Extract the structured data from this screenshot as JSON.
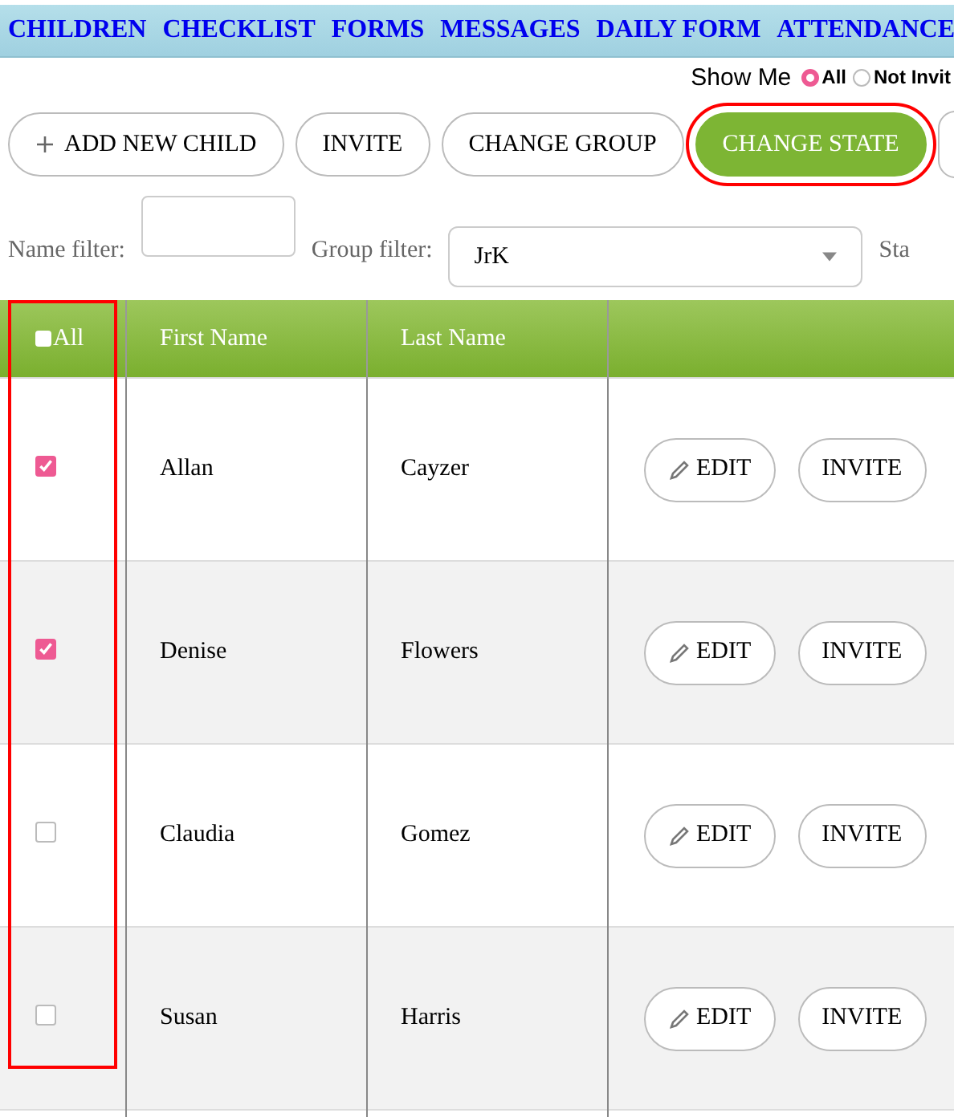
{
  "nav": [
    {
      "label": "CHILDREN"
    },
    {
      "label": "CHECKLIST"
    },
    {
      "label": "FORMS"
    },
    {
      "label": "MESSAGES"
    },
    {
      "label": "DAILY FORM"
    },
    {
      "label": "ATTENDANCE"
    }
  ],
  "show_me": {
    "label": "Show Me",
    "options": [
      {
        "label": "All",
        "selected": true
      },
      {
        "label": "Not Invit",
        "selected": false
      }
    ]
  },
  "actions": [
    {
      "label": "ADD NEW CHILD",
      "kind": "add",
      "primary": false,
      "highlighted": false
    },
    {
      "label": "INVITE",
      "kind": "plain",
      "primary": false,
      "highlighted": false
    },
    {
      "label": "CHANGE GROUP",
      "kind": "plain",
      "primary": false,
      "highlighted": false
    },
    {
      "label": "CHANGE STATE",
      "kind": "plain",
      "primary": true,
      "highlighted": true
    }
  ],
  "filters": {
    "name_label": "Name filter:",
    "group_label": "Group filter:",
    "group_value": "JrK",
    "state_label": "Sta"
  },
  "table": {
    "select_all": {
      "label": "All",
      "checked": false
    },
    "columns": [
      "First Name",
      "Last Name"
    ],
    "checkbox_column_highlighted": true,
    "rows": [
      {
        "checked": true,
        "first": "Allan",
        "last": "Cayzer",
        "edit": "EDIT",
        "invite": "INVITE"
      },
      {
        "checked": true,
        "first": "Denise",
        "last": "Flowers",
        "edit": "EDIT",
        "invite": "INVITE"
      },
      {
        "checked": false,
        "first": "Claudia",
        "last": "Gomez",
        "edit": "EDIT",
        "invite": "INVITE"
      },
      {
        "checked": false,
        "first": "Susan",
        "last": "Harris",
        "edit": "EDIT",
        "invite": "INVITE"
      }
    ]
  }
}
